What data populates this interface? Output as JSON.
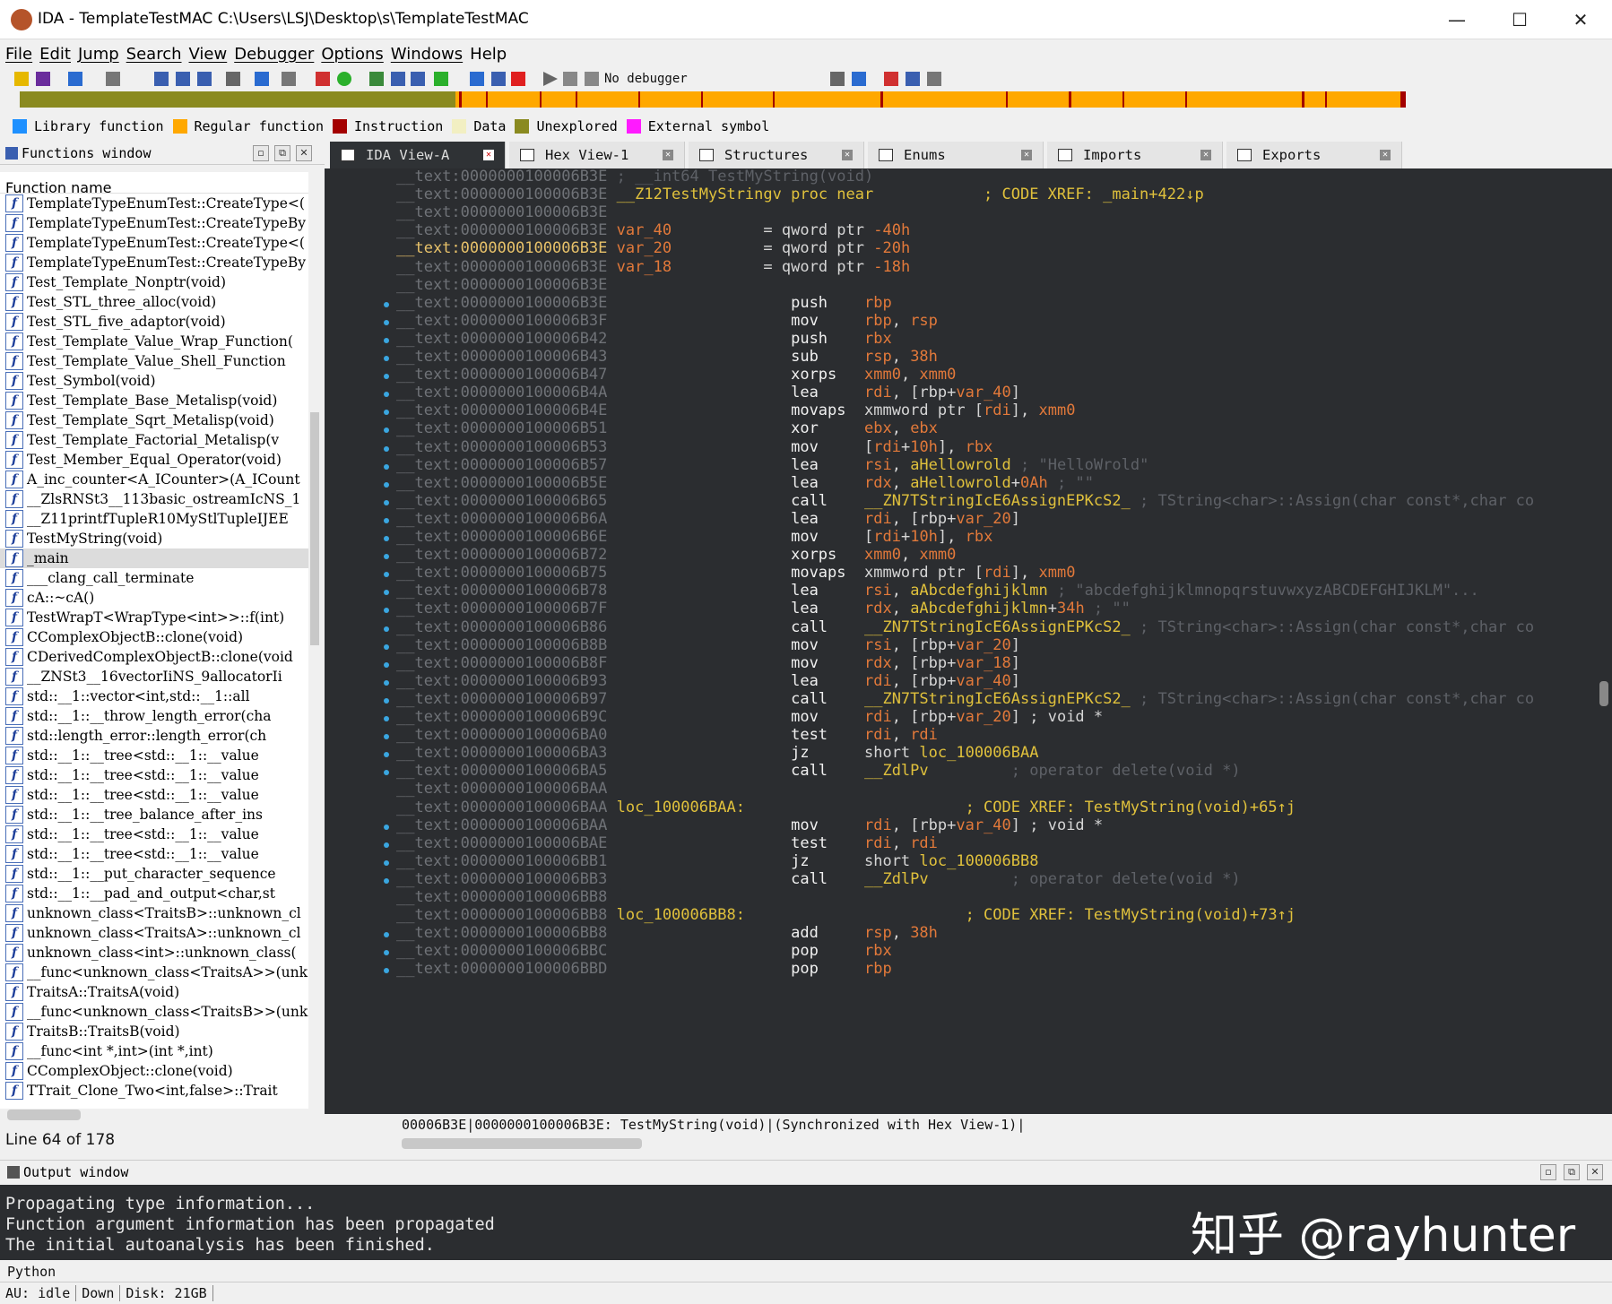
{
  "window": {
    "title": "IDA - TemplateTestMAC C:\\Users\\LSJ\\Desktop\\s\\TemplateTestMAC",
    "minimize": "—",
    "maximize": "☐",
    "close": "✕"
  },
  "menu": [
    "File",
    "Edit",
    "Jump",
    "Search",
    "View",
    "Debugger",
    "Options",
    "Windows",
    "Help"
  ],
  "toolbar": {
    "debugger": "No debugger"
  },
  "legend": [
    {
      "label": "Library function",
      "color": "#1e90ff"
    },
    {
      "label": "Regular function",
      "color": "#ffa800"
    },
    {
      "label": "Instruction",
      "color": "#a30000"
    },
    {
      "label": "Data",
      "color": "#f2efc2"
    },
    {
      "label": "Unexplored",
      "color": "#8a8a20"
    },
    {
      "label": "External symbol",
      "color": "#ff1aff"
    }
  ],
  "functions": {
    "title": "Functions window",
    "column": "Function name",
    "items": [
      "TemplateTypeEnumTest::CreateType<(",
      "TemplateTypeEnumTest::CreateTypeBy",
      "TemplateTypeEnumTest::CreateType<(",
      "TemplateTypeEnumTest::CreateTypeBy",
      "Test_Template_Nonptr(void)",
      "Test_STL_three_alloc(void)",
      "Test_STL_five_adaptor(void)",
      "Test_Template_Value_Wrap_Function(",
      "Test_Template_Value_Shell_Function",
      "Test_Symbol(void)",
      "Test_Template_Base_Metalisp(void)",
      "Test_Template_Sqrt_Metalisp(void)",
      "Test_Template_Factorial_Metalisp(v",
      "Test_Member_Equal_Operator(void)",
      "A_inc_counter<A_ICounter>(A_ICount",
      "__ZlsRNSt3__113basic_ostreamIcNS_1",
      "__Z11printfTupleR10MyStlTupleIJEE",
      "TestMyString(void)",
      "_main",
      "___clang_call_terminate",
      "cA::~cA()",
      "TestWrapT<WrapType<int>>::f(int)",
      "CComplexObjectB::clone(void)",
      "CDerivedComplexObjectB::clone(void",
      "__ZNSt3__16vectorIiNS_9allocatorIi",
      "std::__1::vector<int,std::__1::all",
      "std::__1::__throw_length_error(cha",
      "std::length_error::length_error(ch",
      "std::__1::__tree<std::__1::__value",
      "std::__1::__tree<std::__1::__value",
      "std::__1::__tree<std::__1::__value",
      "std::__1::__tree_balance_after_ins",
      "std::__1::__tree<std::__1::__value",
      "std::__1::__tree<std::__1::__value",
      "std::__1::__put_character_sequence",
      "std::__1::__pad_and_output<char,st",
      "unknown_class<TraitsB>::unknown_cl",
      "unknown_class<TraitsA>::unknown_cl",
      "unknown_class<int>::unknown_class(",
      "__func<unknown_class<TraitsA>>(unk",
      "TraitsA::TraitsA(void)",
      "__func<unknown_class<TraitsB>>(unk",
      "TraitsB::TraitsB(void)",
      "__func<int *,int>(int *,int)",
      "CComplexObject::clone(void)",
      "TTrait_Clone_Two<int,false>::Trait"
    ],
    "selected": 18,
    "line_info": "Line 64 of 178"
  },
  "tabs": [
    "IDA View-A",
    "Hex View-1",
    "Structures",
    "Enums",
    "Imports",
    "Exports"
  ],
  "code": [
    {
      "a": "__text:0000000100006B3E",
      "t": [
        [
          "cmt",
          " ; __int64 TestMyString(void)"
        ]
      ]
    },
    {
      "a": "__text:0000000100006B3E",
      "t": [
        [
          "name",
          " __Z12TestMyStringv"
        ],
        [
          "xr",
          " proc near            ; CODE XREF: _main+422↓p"
        ]
      ]
    },
    {
      "a": "__text:0000000100006B3E",
      "t": []
    },
    {
      "a": "__text:0000000100006B3E",
      "t": [
        [
          "var",
          " var_40"
        ],
        [
          "op",
          "          = qword ptr "
        ],
        [
          "num",
          "-40h"
        ]
      ]
    },
    {
      "a": "__text:0000000100006B3E",
      "t": [
        [
          "var",
          " var_20"
        ],
        [
          "op",
          "          = qword ptr "
        ],
        [
          "num",
          "-20h"
        ]
      ],
      "hl": true
    },
    {
      "a": "__text:0000000100006B3E",
      "t": [
        [
          "var",
          " var_18"
        ],
        [
          "op",
          "          = qword ptr "
        ],
        [
          "num",
          "-18h"
        ]
      ]
    },
    {
      "a": "__text:0000000100006B3E",
      "t": []
    },
    {
      "a": "__text:0000000100006B3E",
      "t": [
        [
          "mn",
          "                    push    "
        ],
        [
          "var",
          "rbp"
        ]
      ],
      "d": 1
    },
    {
      "a": "__text:0000000100006B3F",
      "t": [
        [
          "mn",
          "                    mov     "
        ],
        [
          "var",
          "rbp"
        ],
        [
          "op",
          ", "
        ],
        [
          "var",
          "rsp"
        ]
      ],
      "d": 1
    },
    {
      "a": "__text:0000000100006B42",
      "t": [
        [
          "mn",
          "                    push    "
        ],
        [
          "var",
          "rbx"
        ]
      ],
      "d": 1
    },
    {
      "a": "__text:0000000100006B43",
      "t": [
        [
          "mn",
          "                    sub     "
        ],
        [
          "var",
          "rsp"
        ],
        [
          "op",
          ", "
        ],
        [
          "num",
          "38h"
        ]
      ],
      "d": 1
    },
    {
      "a": "__text:0000000100006B47",
      "t": [
        [
          "mn",
          "                    xorps   "
        ],
        [
          "var",
          "xmm0"
        ],
        [
          "op",
          ", "
        ],
        [
          "var",
          "xmm0"
        ]
      ],
      "d": 1
    },
    {
      "a": "__text:0000000100006B4A",
      "t": [
        [
          "mn",
          "                    lea     "
        ],
        [
          "var",
          "rdi"
        ],
        [
          "op",
          ", [rbp+"
        ],
        [
          "var",
          "var_40"
        ],
        [
          "op",
          "]"
        ]
      ],
      "d": 1
    },
    {
      "a": "__text:0000000100006B4E",
      "t": [
        [
          "mn",
          "                    movaps  "
        ],
        [
          "op",
          "xmmword ptr ["
        ],
        [
          "var",
          "rdi"
        ],
        [
          "op",
          "], "
        ],
        [
          "var",
          "xmm0"
        ]
      ],
      "d": 1
    },
    {
      "a": "__text:0000000100006B51",
      "t": [
        [
          "mn",
          "                    xor     "
        ],
        [
          "var",
          "ebx"
        ],
        [
          "op",
          ", "
        ],
        [
          "var",
          "ebx"
        ]
      ],
      "d": 1
    },
    {
      "a": "__text:0000000100006B53",
      "t": [
        [
          "mn",
          "                    mov     "
        ],
        [
          "op",
          "["
        ],
        [
          "var",
          "rdi"
        ],
        [
          "op",
          "+"
        ],
        [
          "num",
          "10h"
        ],
        [
          "op",
          "], "
        ],
        [
          "var",
          "rbx"
        ]
      ],
      "d": 1
    },
    {
      "a": "__text:0000000100006B57",
      "t": [
        [
          "mn",
          "                    lea     "
        ],
        [
          "var",
          "rsi"
        ],
        [
          "op",
          ", "
        ],
        [
          "name",
          "aHellowrold"
        ],
        [
          "cmt",
          " ; \"HelloWrold\""
        ]
      ],
      "d": 1
    },
    {
      "a": "__text:0000000100006B5E",
      "t": [
        [
          "mn",
          "                    lea     "
        ],
        [
          "var",
          "rdx"
        ],
        [
          "op",
          ", "
        ],
        [
          "name",
          "aHellowrold"
        ],
        [
          "op",
          "+"
        ],
        [
          "num",
          "0Ah"
        ],
        [
          "cmt",
          " ; \"\""
        ]
      ],
      "d": 1
    },
    {
      "a": "__text:0000000100006B65",
      "t": [
        [
          "mn",
          "                    call    "
        ],
        [
          "name",
          "__ZN7TStringIcE6AssignEPKcS2_"
        ],
        [
          "cmt",
          " ; TString<char>::Assign(char const*,char co"
        ]
      ],
      "d": 1
    },
    {
      "a": "__text:0000000100006B6A",
      "t": [
        [
          "mn",
          "                    lea     "
        ],
        [
          "var",
          "rdi"
        ],
        [
          "op",
          ", [rbp+"
        ],
        [
          "var",
          "var_20"
        ],
        [
          "op",
          "]"
        ]
      ],
      "d": 1
    },
    {
      "a": "__text:0000000100006B6E",
      "t": [
        [
          "mn",
          "                    mov     "
        ],
        [
          "op",
          "["
        ],
        [
          "var",
          "rdi"
        ],
        [
          "op",
          "+"
        ],
        [
          "num",
          "10h"
        ],
        [
          "op",
          "], "
        ],
        [
          "var",
          "rbx"
        ]
      ],
      "d": 1
    },
    {
      "a": "__text:0000000100006B72",
      "t": [
        [
          "mn",
          "                    xorps   "
        ],
        [
          "var",
          "xmm0"
        ],
        [
          "op",
          ", "
        ],
        [
          "var",
          "xmm0"
        ]
      ],
      "d": 1
    },
    {
      "a": "__text:0000000100006B75",
      "t": [
        [
          "mn",
          "                    movaps  "
        ],
        [
          "op",
          "xmmword ptr ["
        ],
        [
          "var",
          "rdi"
        ],
        [
          "op",
          "], "
        ],
        [
          "var",
          "xmm0"
        ]
      ],
      "d": 1
    },
    {
      "a": "__text:0000000100006B78",
      "t": [
        [
          "mn",
          "                    lea     "
        ],
        [
          "var",
          "rsi"
        ],
        [
          "op",
          ", "
        ],
        [
          "name",
          "aAbcdefghijklmn"
        ],
        [
          "cmt",
          " ; \"abcdefghijklmnopqrstuvwxyzABCDEFGHIJKLM\"..."
        ]
      ],
      "d": 1
    },
    {
      "a": "__text:0000000100006B7F",
      "t": [
        [
          "mn",
          "                    lea     "
        ],
        [
          "var",
          "rdx"
        ],
        [
          "op",
          ", "
        ],
        [
          "name",
          "aAbcdefghijklmn"
        ],
        [
          "op",
          "+"
        ],
        [
          "num",
          "34h"
        ],
        [
          "cmt",
          " ; \"\""
        ]
      ],
      "d": 1
    },
    {
      "a": "__text:0000000100006B86",
      "t": [
        [
          "mn",
          "                    call    "
        ],
        [
          "name",
          "__ZN7TStringIcE6AssignEPKcS2_"
        ],
        [
          "cmt",
          " ; TString<char>::Assign(char const*,char co"
        ]
      ],
      "d": 1
    },
    {
      "a": "__text:0000000100006B8B",
      "t": [
        [
          "mn",
          "                    mov     "
        ],
        [
          "var",
          "rsi"
        ],
        [
          "op",
          ", [rbp+"
        ],
        [
          "var",
          "var_20"
        ],
        [
          "op",
          "]"
        ]
      ],
      "d": 1
    },
    {
      "a": "__text:0000000100006B8F",
      "t": [
        [
          "mn",
          "                    mov     "
        ],
        [
          "var",
          "rdx"
        ],
        [
          "op",
          ", [rbp+"
        ],
        [
          "var",
          "var_18"
        ],
        [
          "op",
          "]"
        ]
      ],
      "d": 1
    },
    {
      "a": "__text:0000000100006B93",
      "t": [
        [
          "mn",
          "                    lea     "
        ],
        [
          "var",
          "rdi"
        ],
        [
          "op",
          ", [rbp+"
        ],
        [
          "var",
          "var_40"
        ],
        [
          "op",
          "]"
        ]
      ],
      "d": 1
    },
    {
      "a": "__text:0000000100006B97",
      "t": [
        [
          "mn",
          "                    call    "
        ],
        [
          "name",
          "__ZN7TStringIcE6AssignEPKcS2_"
        ],
        [
          "cmt",
          " ; TString<char>::Assign(char const*,char co"
        ]
      ],
      "d": 1
    },
    {
      "a": "__text:0000000100006B9C",
      "t": [
        [
          "mn",
          "                    mov     "
        ],
        [
          "var",
          "rdi"
        ],
        [
          "op",
          ", [rbp+"
        ],
        [
          "var",
          "var_20"
        ],
        [
          "op",
          "] ; void *"
        ]
      ],
      "d": 1
    },
    {
      "a": "__text:0000000100006BA0",
      "t": [
        [
          "mn",
          "                    test    "
        ],
        [
          "var",
          "rdi"
        ],
        [
          "op",
          ", "
        ],
        [
          "var",
          "rdi"
        ]
      ],
      "d": 1
    },
    {
      "a": "__text:0000000100006BA3",
      "t": [
        [
          "mn",
          "                    jz      "
        ],
        [
          "op",
          "short "
        ],
        [
          "name",
          "loc_100006BAA"
        ]
      ],
      "d": 1
    },
    {
      "a": "__text:0000000100006BA5",
      "t": [
        [
          "mn",
          "                    call    "
        ],
        [
          "name",
          "__ZdlPv"
        ],
        [
          "cmt",
          "         ; operator delete(void *)"
        ]
      ],
      "d": 1
    },
    {
      "a": "__text:0000000100006BAA",
      "t": []
    },
    {
      "a": "__text:0000000100006BAA",
      "t": [
        [
          "name",
          " loc_100006BAA:"
        ],
        [
          "xr",
          "                        ; CODE XREF: TestMyString(void)+65↑j"
        ]
      ]
    },
    {
      "a": "__text:0000000100006BAA",
      "t": [
        [
          "mn",
          "                    mov     "
        ],
        [
          "var",
          "rdi"
        ],
        [
          "op",
          ", [rbp+"
        ],
        [
          "var",
          "var_40"
        ],
        [
          "op",
          "] ; void *"
        ]
      ],
      "d": 1
    },
    {
      "a": "__text:0000000100006BAE",
      "t": [
        [
          "mn",
          "                    test    "
        ],
        [
          "var",
          "rdi"
        ],
        [
          "op",
          ", "
        ],
        [
          "var",
          "rdi"
        ]
      ],
      "d": 1
    },
    {
      "a": "__text:0000000100006BB1",
      "t": [
        [
          "mn",
          "                    jz      "
        ],
        [
          "op",
          "short "
        ],
        [
          "name",
          "loc_100006BB8"
        ]
      ],
      "d": 1
    },
    {
      "a": "__text:0000000100006BB3",
      "t": [
        [
          "mn",
          "                    call    "
        ],
        [
          "name",
          "__ZdlPv"
        ],
        [
          "cmt",
          "         ; operator delete(void *)"
        ]
      ],
      "d": 1
    },
    {
      "a": "__text:0000000100006BB8",
      "t": []
    },
    {
      "a": "__text:0000000100006BB8",
      "t": [
        [
          "name",
          " loc_100006BB8:"
        ],
        [
          "xr",
          "                        ; CODE XREF: TestMyString(void)+73↑j"
        ]
      ]
    },
    {
      "a": "__text:0000000100006BB8",
      "t": [
        [
          "mn",
          "                    add     "
        ],
        [
          "var",
          "rsp"
        ],
        [
          "op",
          ", "
        ],
        [
          "num",
          "38h"
        ]
      ],
      "d": 1
    },
    {
      "a": "__text:0000000100006BBC",
      "t": [
        [
          "mn",
          "                    pop     "
        ],
        [
          "var",
          "rbx"
        ]
      ],
      "d": 1
    },
    {
      "a": "__text:0000000100006BBD",
      "t": [
        [
          "mn",
          "                    pop     "
        ],
        [
          "var",
          "rbp"
        ]
      ],
      "d": 1
    }
  ],
  "code_status": "00006B3E|0000000100006B3E: TestMyString(void)|(Synchronized with Hex View-1)|",
  "output": {
    "title": "Output window",
    "text": "Propagating type information...\nFunction argument information has been propagated\nThe initial autoanalysis has been finished."
  },
  "watermark": "知乎 @rayhunter",
  "python_label": "Python",
  "status": {
    "au": "AU:  idle",
    "dir": "Down",
    "disk": "Disk: 21GB"
  }
}
